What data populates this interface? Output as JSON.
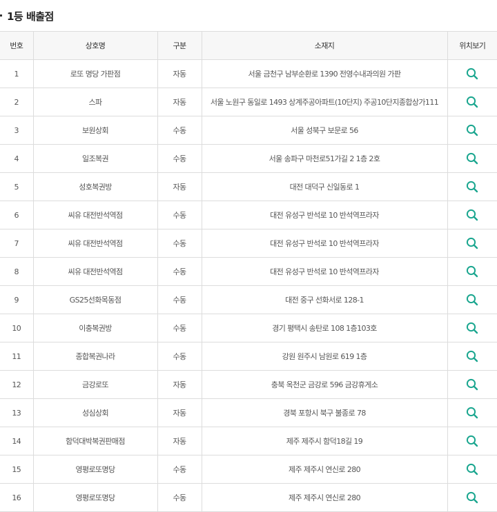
{
  "heading": {
    "title": "1등 배출점"
  },
  "table": {
    "columns": [
      "번호",
      "상호명",
      "구분",
      "소재지",
      "위치보기"
    ],
    "rows": [
      {
        "no": "1",
        "name": "로또 명당 가판점",
        "type": "자동",
        "address": "서울 금천구 남부순환로 1390 전영수내과의원 가판"
      },
      {
        "no": "2",
        "name": "스파",
        "type": "자동",
        "address": "서울 노원구 동일로 1493 상계주공아파트(10단지) 주공10단지종합상가111"
      },
      {
        "no": "3",
        "name": "보원상회",
        "type": "수동",
        "address": "서울 성북구 보문로 56"
      },
      {
        "no": "4",
        "name": "일조복권",
        "type": "수동",
        "address": "서울 송파구 마천로51가길 2 1층 2호"
      },
      {
        "no": "5",
        "name": "성호복권방",
        "type": "자동",
        "address": "대전 대덕구 신일동로 1"
      },
      {
        "no": "6",
        "name": "씨유 대전반석역점",
        "type": "수동",
        "address": "대전 유성구 반석로 10 반석역프라자"
      },
      {
        "no": "7",
        "name": "씨유 대전반석역점",
        "type": "수동",
        "address": "대전 유성구 반석로 10 반석역프라자"
      },
      {
        "no": "8",
        "name": "씨유 대전반석역점",
        "type": "수동",
        "address": "대전 유성구 반석로 10 반석역프라자"
      },
      {
        "no": "9",
        "name": "GS25선화목동점",
        "type": "수동",
        "address": "대전 중구 선화서로 128-1"
      },
      {
        "no": "10",
        "name": "이충복권방",
        "type": "수동",
        "address": "경기 평택시 송탄로 108 1층103호"
      },
      {
        "no": "11",
        "name": "종합복권나라",
        "type": "수동",
        "address": "강원 원주시 남원로 619 1층"
      },
      {
        "no": "12",
        "name": "금강로또",
        "type": "자동",
        "address": "충북 옥천군 금강로 596 금강휴게소"
      },
      {
        "no": "13",
        "name": "성심상회",
        "type": "자동",
        "address": "경북 포항시 북구 불종로 78"
      },
      {
        "no": "14",
        "name": "함덕대박복권판매점",
        "type": "자동",
        "address": "제주 제주시 함덕18길 19"
      },
      {
        "no": "15",
        "name": "영평로또명당",
        "type": "수동",
        "address": "제주 제주시 연신로 280"
      },
      {
        "no": "16",
        "name": "영평로또명당",
        "type": "수동",
        "address": "제주 제주시 연신로 280"
      }
    ]
  },
  "icons": {
    "location": "search-icon"
  },
  "colors": {
    "icon": "#1aa68f",
    "header_bg": "#f7f7f7",
    "border": "#dcdcdc",
    "top_border": "#333333"
  }
}
